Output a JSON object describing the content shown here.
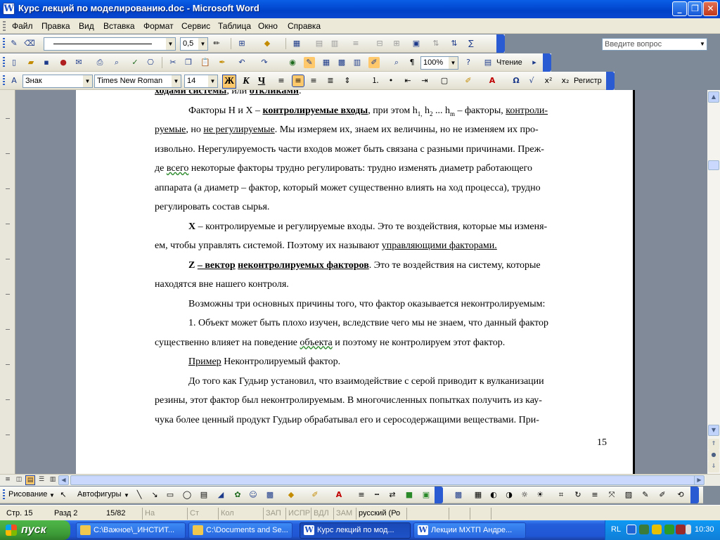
{
  "window": {
    "title": "Курс лекций по моделированию.doc - Microsoft Word"
  },
  "menu": {
    "items": [
      "Файл",
      "Правка",
      "Вид",
      "Вставка",
      "Формат",
      "Сервис",
      "Таблица",
      "Окно",
      "Справка"
    ],
    "ask_placeholder": "Введите вопрос"
  },
  "toolbar1": {
    "line_weight": "0,5"
  },
  "toolbar2": {
    "zoom": "100%",
    "read_label": "Чтение"
  },
  "toolbar3": {
    "style": "Знак",
    "font": "Times New Roman",
    "size": "14",
    "bold": "Ж",
    "italic": "К",
    "underline": "Ч",
    "register_label": "Регистр"
  },
  "document": {
    "lines": [
      {
        "segments": [
          {
            "t": "ходами системы",
            "s": "bu"
          },
          {
            "t": ", или "
          },
          {
            "t": "откликами",
            "s": "bu"
          },
          {
            "t": "."
          }
        ]
      },
      {
        "indent": true,
        "segments": [
          {
            "t": "Факторы Н и Х – "
          },
          {
            "t": "контролируемые входы",
            "s": "bu"
          },
          {
            "t": ", при этом h"
          },
          {
            "t": "1,",
            "s": "sub"
          },
          {
            "t": " h"
          },
          {
            "t": "2",
            "s": "sub"
          },
          {
            "t": " ... h"
          },
          {
            "t": "m",
            "s": "sub"
          },
          {
            "t": " – факторы, "
          },
          {
            "t": "контроли-",
            "s": "u"
          }
        ]
      },
      {
        "segments": [
          {
            "t": "руемые",
            "s": "u"
          },
          {
            "t": ", но "
          },
          {
            "t": "не регулируемые",
            "s": "u"
          },
          {
            "t": ".  Мы измеряем их, знаем их величины, но не изменяем их про-"
          }
        ]
      },
      {
        "segments": [
          {
            "t": "извольно. Нерегулируемость части входов может быть связана с разными причинами. Преж-"
          }
        ]
      },
      {
        "segments": [
          {
            "t": "де "
          },
          {
            "t": "всего",
            "s": "w"
          },
          {
            "t": " некоторые факторы трудно регулировать: трудно изменять диаметр работающего"
          }
        ]
      },
      {
        "segments": [
          {
            "t": "аппарата (а диаметр – фактор, который может существенно влиять на ход процесса), трудно"
          }
        ]
      },
      {
        "segments": [
          {
            "t": "регулировать состав сырья."
          }
        ]
      },
      {
        "indent": true,
        "segments": [
          {
            "t": "Х",
            "s": "b"
          },
          {
            "t": " – контролируемые и регулируемые входы. Это те воздействия, которые мы изменя-"
          }
        ]
      },
      {
        "segments": [
          {
            "t": "ем, чтобы управлять системой. Поэтому их называют "
          },
          {
            "t": "управляющими факторами.",
            "s": "u"
          }
        ]
      },
      {
        "indent": true,
        "segments": [
          {
            "t": "Z",
            "s": "b"
          },
          {
            "t": " "
          },
          {
            "t": "– вектор",
            "s": "bu"
          },
          {
            "t": " "
          },
          {
            "t": "неконтролируемых факторов",
            "s": "bu"
          },
          {
            "t": ". Это те воздействия на систему, которые"
          }
        ]
      },
      {
        "segments": [
          {
            "t": "находятся вне нашего контроля."
          }
        ]
      },
      {
        "indent": true,
        "segments": [
          {
            "t": "Возможны три основных причины того, что фактор оказывается неконтролируемым:"
          }
        ]
      },
      {
        "indent": true,
        "segments": [
          {
            "t": "1. Объект может быть плохо изучен, вследствие чего мы не знаем, что данный фактор"
          }
        ]
      },
      {
        "segments": [
          {
            "t": "существенно влияет на поведение "
          },
          {
            "t": "объекта",
            "s": "w"
          },
          {
            "t": " и поэтому не контролируем этот фактор."
          }
        ]
      },
      {
        "indent": true,
        "segments": [
          {
            "t": "Пример",
            "s": "u"
          },
          {
            "t": " Неконтролируемый фактор."
          }
        ]
      },
      {
        "indent": true,
        "segments": [
          {
            "t": "До того как Гудьир установил, что взаимодействие с серой приводит к  вулканизации"
          }
        ]
      },
      {
        "segments": [
          {
            "t": "резины, этот фактор был неконтролируемым. В многочисленных попытках получить из кау-"
          }
        ]
      },
      {
        "segments": [
          {
            "t": "чука более ценный продукт Гудьир обрабатывал его и серосодержащими веществами. При-"
          }
        ]
      }
    ],
    "page_number": "15"
  },
  "drawing": {
    "draw_label": "Рисование",
    "autoshapes_label": "Автофигуры"
  },
  "status": {
    "page": "Стр.  15",
    "section": "Разд  2",
    "pages": "15/82",
    "at": "На",
    "line": "Ст",
    "col": "Кол",
    "rec": "ЗАП",
    "trk": "ИСПР",
    "ext": "ВДЛ",
    "ovr": "ЗАМ",
    "lang": "русский (Ро"
  },
  "taskbar": {
    "start_label": "пуск",
    "tasks": [
      "C:\\Важное\\_ИНСТИТ...",
      "C:\\Documents and Se...",
      "Курс лекций по мод...",
      "Лекции МХТП Андре..."
    ],
    "lang": "RL",
    "clock": "10:30"
  }
}
